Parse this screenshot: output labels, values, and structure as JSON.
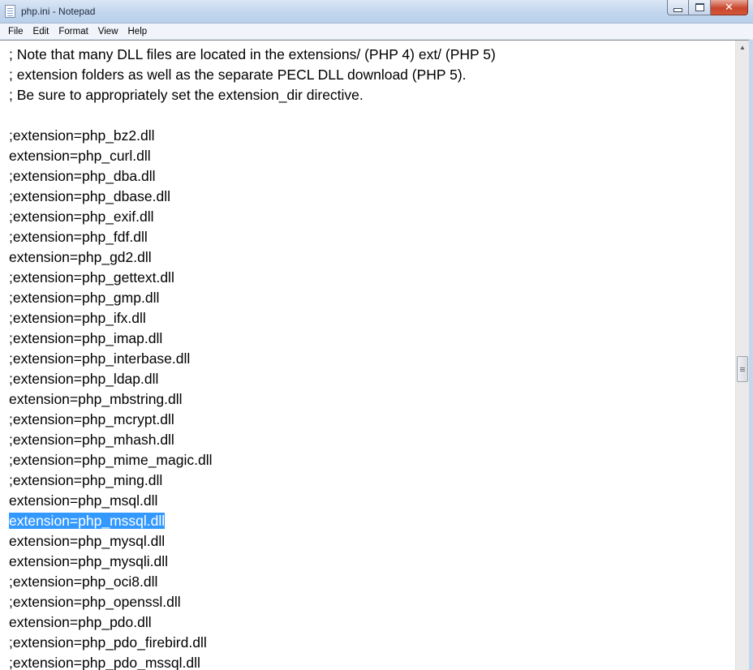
{
  "window": {
    "title": "php.ini - Notepad",
    "controls": {
      "minimize_icon": "minimize-icon",
      "maximize_icon": "maximize-icon",
      "close_icon": "close-icon"
    }
  },
  "menu": [
    "File",
    "Edit",
    "Format",
    "View",
    "Help"
  ],
  "editor": {
    "lines": [
      "; Note that many DLL files are located in the extensions/ (PHP 4) ext/ (PHP 5)",
      "; extension folders as well as the separate PECL DLL download (PHP 5).",
      "; Be sure to appropriately set the extension_dir directive.",
      "",
      ";extension=php_bz2.dll",
      "extension=php_curl.dll",
      ";extension=php_dba.dll",
      ";extension=php_dbase.dll",
      ";extension=php_exif.dll",
      ";extension=php_fdf.dll",
      "extension=php_gd2.dll",
      ";extension=php_gettext.dll",
      ";extension=php_gmp.dll",
      ";extension=php_ifx.dll",
      ";extension=php_imap.dll",
      ";extension=php_interbase.dll",
      ";extension=php_ldap.dll",
      "extension=php_mbstring.dll",
      ";extension=php_mcrypt.dll",
      ";extension=php_mhash.dll",
      ";extension=php_mime_magic.dll",
      ";extension=php_ming.dll",
      "extension=php_msql.dll",
      "extension=php_mssql.dll",
      "extension=php_mysql.dll",
      "extension=php_mysqli.dll",
      ";extension=php_oci8.dll",
      ";extension=php_openssl.dll",
      "extension=php_pdo.dll",
      ";extension=php_pdo_firebird.dll",
      ";extension=php_pdo_mssql.dll"
    ],
    "selected_line_index": 23
  },
  "colors": {
    "selection": "#3399ff",
    "titlebar": "#c3d6ee",
    "close_button": "#c9462c"
  }
}
